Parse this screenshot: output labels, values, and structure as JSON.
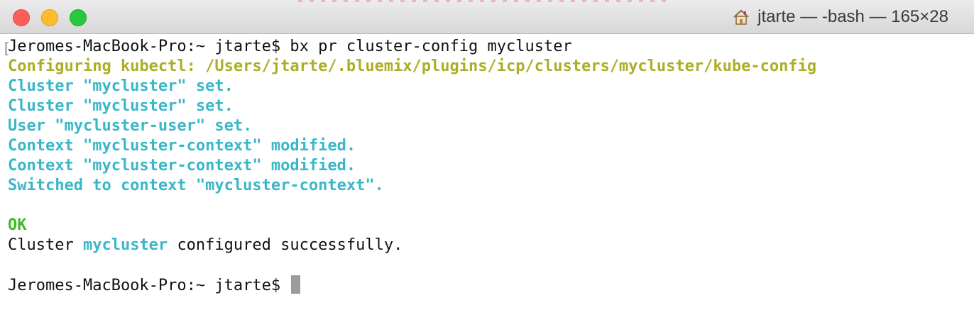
{
  "window": {
    "title": "jtarte — -bash — 165×28",
    "icon": "home-icon"
  },
  "terminal": {
    "prompt": "Jeromes-MacBook-Pro:~ jtarte$",
    "command": "bx pr cluster-config mycluster",
    "output_configuring": "Configuring kubectl: /Users/jtarte/.bluemix/plugins/icp/clusters/mycluster/kube-config",
    "output_cluster_set_1": "Cluster \"mycluster\" set.",
    "output_cluster_set_2": "Cluster \"mycluster\" set.",
    "output_user_set": "User \"mycluster-user\" set.",
    "output_context_modified_1": "Context \"mycluster-context\" modified.",
    "output_context_modified_2": "Context \"mycluster-context\" modified.",
    "output_switched": "Switched to context \"mycluster-context\".",
    "ok": "OK",
    "success_prefix": "Cluster",
    "success_name": "mycluster",
    "success_suffix": "configured successfully.",
    "final_prompt": "Jeromes-MacBook-Pro:~ jtarte$"
  },
  "colors": {
    "yellow": "#adad27",
    "cyan": "#3ab7c7",
    "green": "#3fba25",
    "close": "#fc5f57",
    "minimize": "#fdbc2e",
    "zoom": "#29c840"
  }
}
